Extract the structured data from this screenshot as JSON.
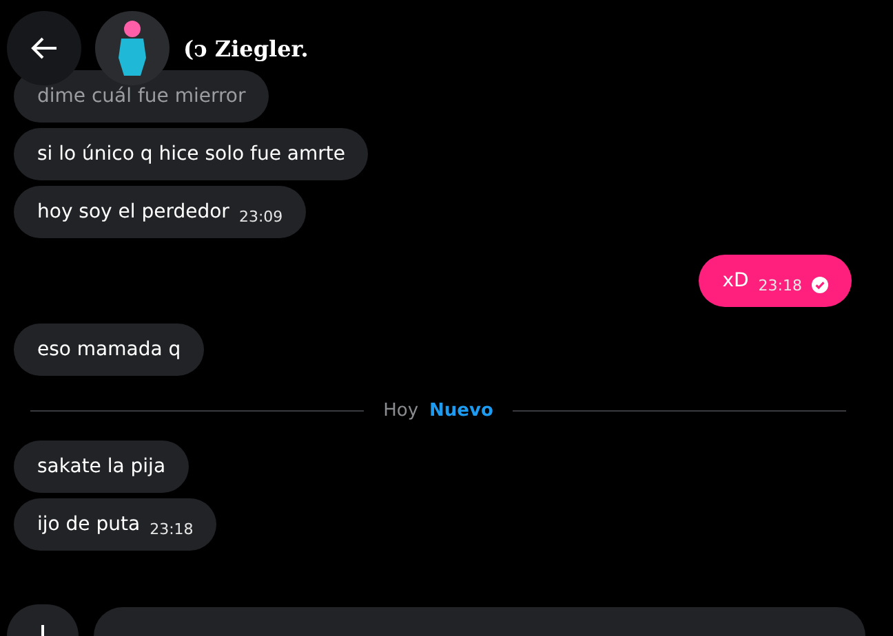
{
  "header": {
    "name": "(ↄ Ziegler."
  },
  "messages": [
    {
      "kind": "received",
      "text": "dime cuál fue mierror",
      "faded": true
    },
    {
      "kind": "received",
      "text": "si lo único q hice solo fue amrte",
      "faded": false
    },
    {
      "kind": "received",
      "text": "hoy soy el perdedor",
      "time": "23:09",
      "faded": false
    },
    {
      "kind": "sent",
      "text": "xD",
      "time": "23:18",
      "read": true,
      "faded": false
    },
    {
      "kind": "received",
      "text": "eso mamada q",
      "faded": false
    },
    {
      "kind": "divider",
      "text": "Hoy",
      "badge": "Nuevo"
    },
    {
      "kind": "received",
      "text": "sakate la pija",
      "faded": false
    },
    {
      "kind": "received",
      "text": "ijo de puta",
      "time": "23:18",
      "faded": false
    }
  ]
}
